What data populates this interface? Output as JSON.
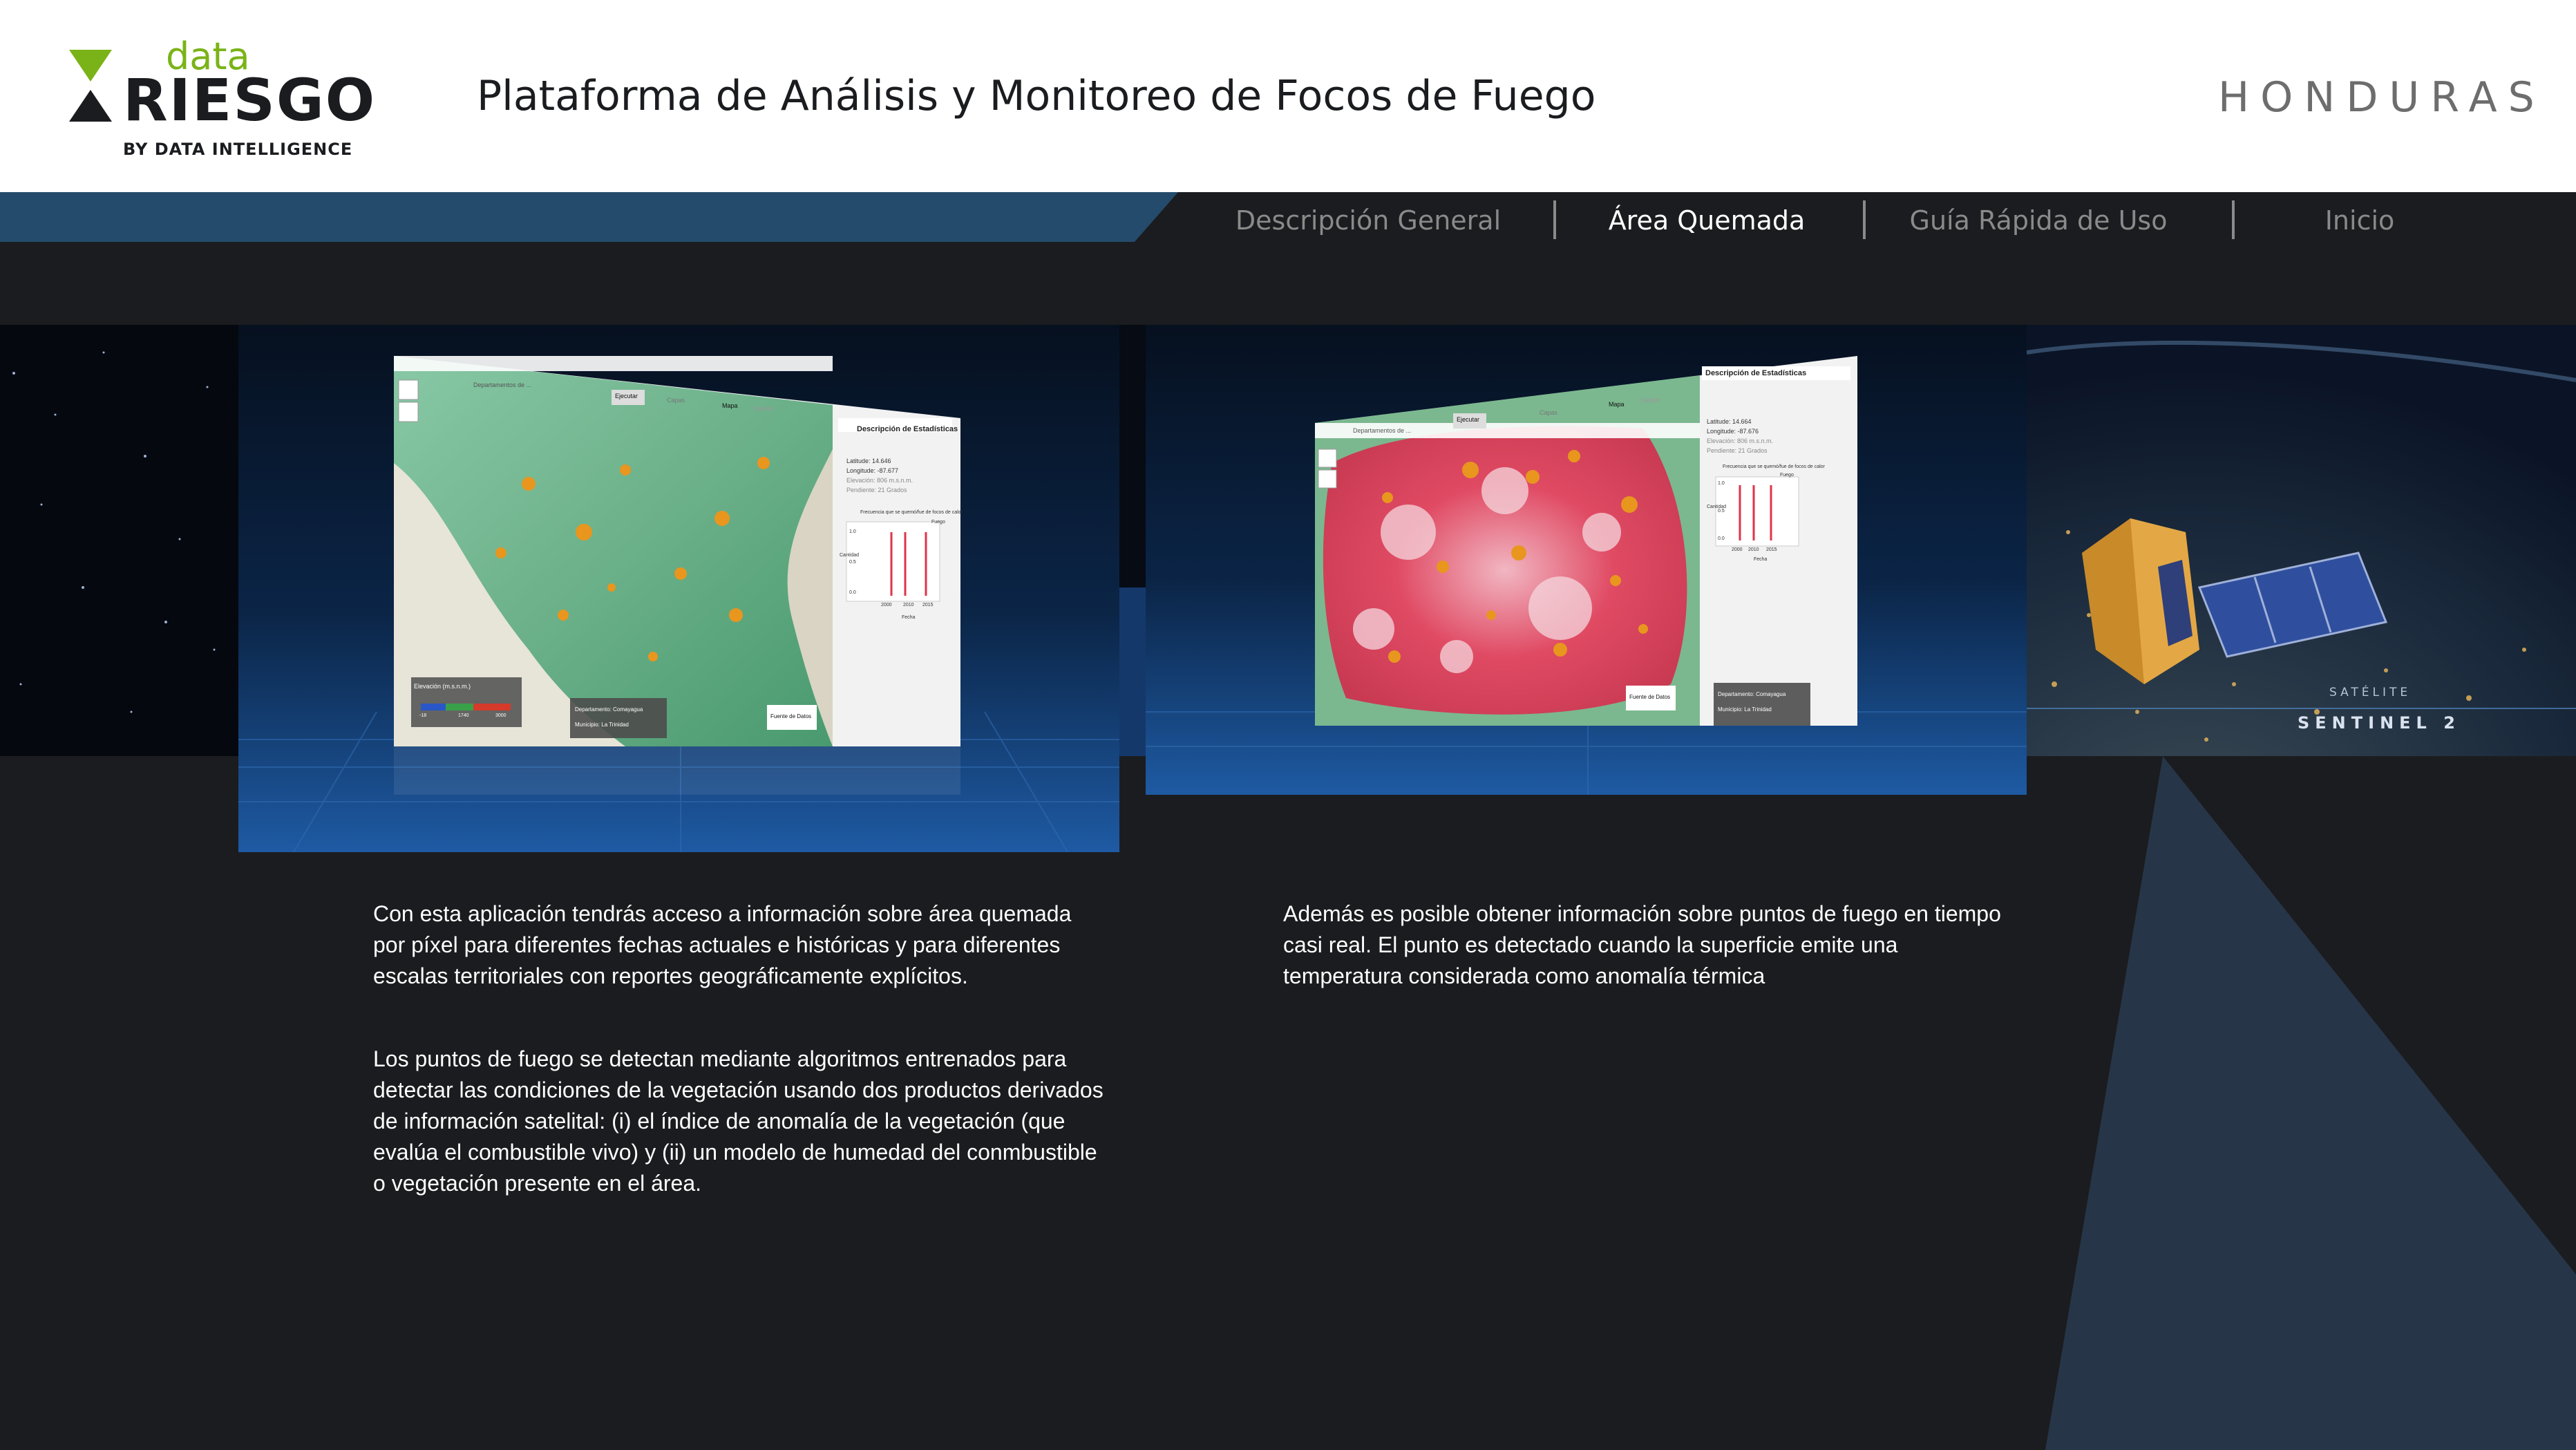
{
  "header": {
    "logo": {
      "word_data": "data",
      "word_riesgo": "RIESGO",
      "byline": "BY DATA INTELLIGENCE"
    },
    "title": "Plataforma de Análisis y Monitoreo de Focos de Fuego",
    "country": "HONDURAS"
  },
  "nav": {
    "items": [
      {
        "label": "Descripción General",
        "active": false
      },
      {
        "label": "Área Quemada",
        "active": true
      },
      {
        "label": "Guía Rápida de Uso",
        "active": false
      },
      {
        "label": "Inicio",
        "active": false
      }
    ]
  },
  "panels": {
    "burned_area": {
      "toolbar": {
        "search_placeholder": "Departamentos de ...",
        "run_button": "Ejecutar",
        "layers": "Capas",
        "map": "Mapa",
        "satellite": "Satélite"
      },
      "stats": {
        "title": "Descripción de Estadísticas",
        "latitude": "Latitude: 14.646",
        "longitude": "Longitude: -87.677",
        "elevation": "Elevación: 806 m.s.n.m.",
        "slope": "Pendiente: 21 Grados",
        "chart_title": "Frecuencia que se quemó/fue de focos de calor",
        "legend": "Fuego",
        "ylabel": "Cantidad",
        "xlabel": "Fecha",
        "x_ticks": [
          "2000",
          "2010",
          "2015"
        ],
        "y_ticks": [
          "1.0",
          "0.5",
          "0.0"
        ]
      },
      "legend": {
        "title": "Elevación (m.s.n.m.)",
        "ticks": [
          "-18",
          "1740",
          "3000"
        ]
      },
      "popup": {
        "department": "Departamento: Comayagua",
        "municipality": "Municipio: La Trinidad",
        "button": "Fuente de Datos"
      }
    },
    "fire_points": {
      "toolbar": {
        "search_placeholder": "Departamentos de ...",
        "run_button": "Ejecutar",
        "layers": "Capas",
        "map": "Mapa",
        "satellite": "Satélite"
      },
      "stats": {
        "title": "Descripción de Estadísticas",
        "latitude": "Latitude: 14.664",
        "longitude": "Longitude: -87.676",
        "elevation": "Elevación: 806 m.s.n.m.",
        "slope": "Pendiente: 21 Grados",
        "chart_title": "Frecuencia que se quemó/fue de focos de calor",
        "legend": "Fuego",
        "ylabel": "Cantidad",
        "xlabel": "Fecha",
        "x_ticks": [
          "2000",
          "2010",
          "2015"
        ],
        "y_ticks": [
          "1.0",
          "0.5",
          "0.0"
        ]
      },
      "popup": {
        "department": "Departamento: Comayagua",
        "municipality": "Municipio: La Trinidad",
        "button": "Fuente de Datos"
      }
    },
    "satellite": {
      "label_small": "SATÉLITE",
      "label_big": "SENTINEL 2"
    }
  },
  "text": {
    "left_paragraph_1": "Con esta aplicación tendrás acceso a información sobre área quemada por píxel para diferentes fechas actuales e históricas y para diferentes escalas territoriales con reportes geográficamente explícitos.",
    "left_paragraph_2": "Los puntos de fuego se detectan mediante algoritmos entrenados para detectar las condiciones de la vegetación usando dos productos derivados de información satelital: (i) el índice de anomalía de la vegetación (que evalúa el combustible vivo) y (ii) un modelo de humedad del conmbustible o vegetación presente en el área.",
    "right_paragraph_1": "Además es posible obtener información sobre puntos de fuego en tiempo casi real. El punto es detectado cuando la superficie emite una temperatura considerada como anomalía térmica"
  },
  "colors": {
    "accent_green": "#7ab317",
    "nav_band": "#244b6b",
    "background": "#1b1c1f",
    "fire_orange": "#e8961e",
    "fire_red": "#e0334a"
  }
}
